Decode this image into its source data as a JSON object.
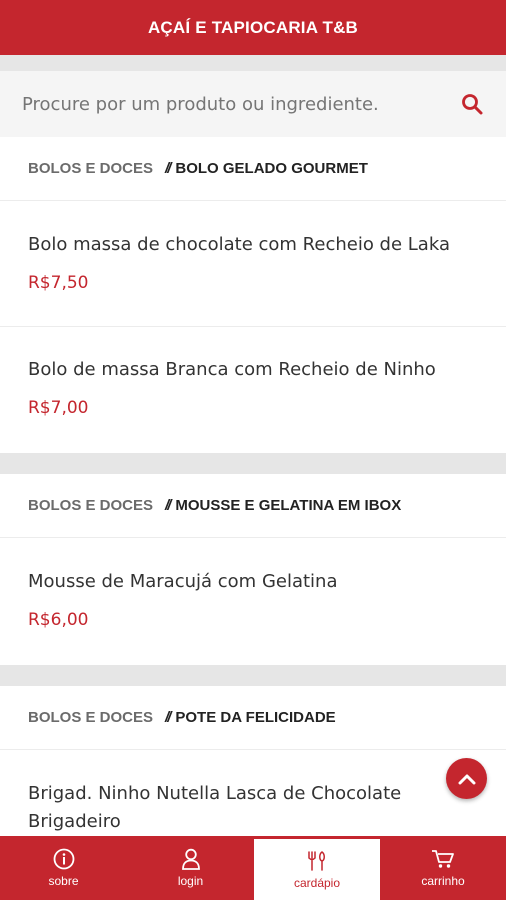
{
  "header": {
    "title": "AÇAÍ E TAPIOCARIA T&B"
  },
  "search": {
    "placeholder": "Procure por um produto ou ingrediente."
  },
  "sections": [
    {
      "category": "BOLOS E DOCES",
      "separator": "//",
      "subcategory": "BOLO GELADO GOURMET",
      "items": [
        {
          "name": "Bolo massa de chocolate com Recheio de Laka",
          "price": "R$7,50"
        },
        {
          "name": "Bolo de massa Branca com Recheio de Ninho",
          "price": "R$7,00"
        }
      ]
    },
    {
      "category": "BOLOS E DOCES",
      "separator": "//",
      "subcategory": "MOUSSE E GELATINA EM IBOX",
      "items": [
        {
          "name": "Mousse de Maracujá com Gelatina",
          "price": "R$6,00"
        }
      ]
    },
    {
      "category": "BOLOS E DOCES",
      "separator": "//",
      "subcategory": "POTE DA FELICIDADE",
      "items": [
        {
          "name_line1": "Brigad. Ninho Nutella Lasca de Chocolate",
          "name_line2": "Brigadeiro"
        }
      ]
    }
  ],
  "nav": [
    {
      "label": "sobre",
      "icon": "info-icon"
    },
    {
      "label": "login",
      "icon": "user-icon"
    },
    {
      "label": "cardápio",
      "icon": "cutlery-icon",
      "active": true
    },
    {
      "label": "carrinho",
      "icon": "cart-icon"
    }
  ],
  "colors": {
    "brand": "#c4262e",
    "background": "#e6e6e6"
  }
}
